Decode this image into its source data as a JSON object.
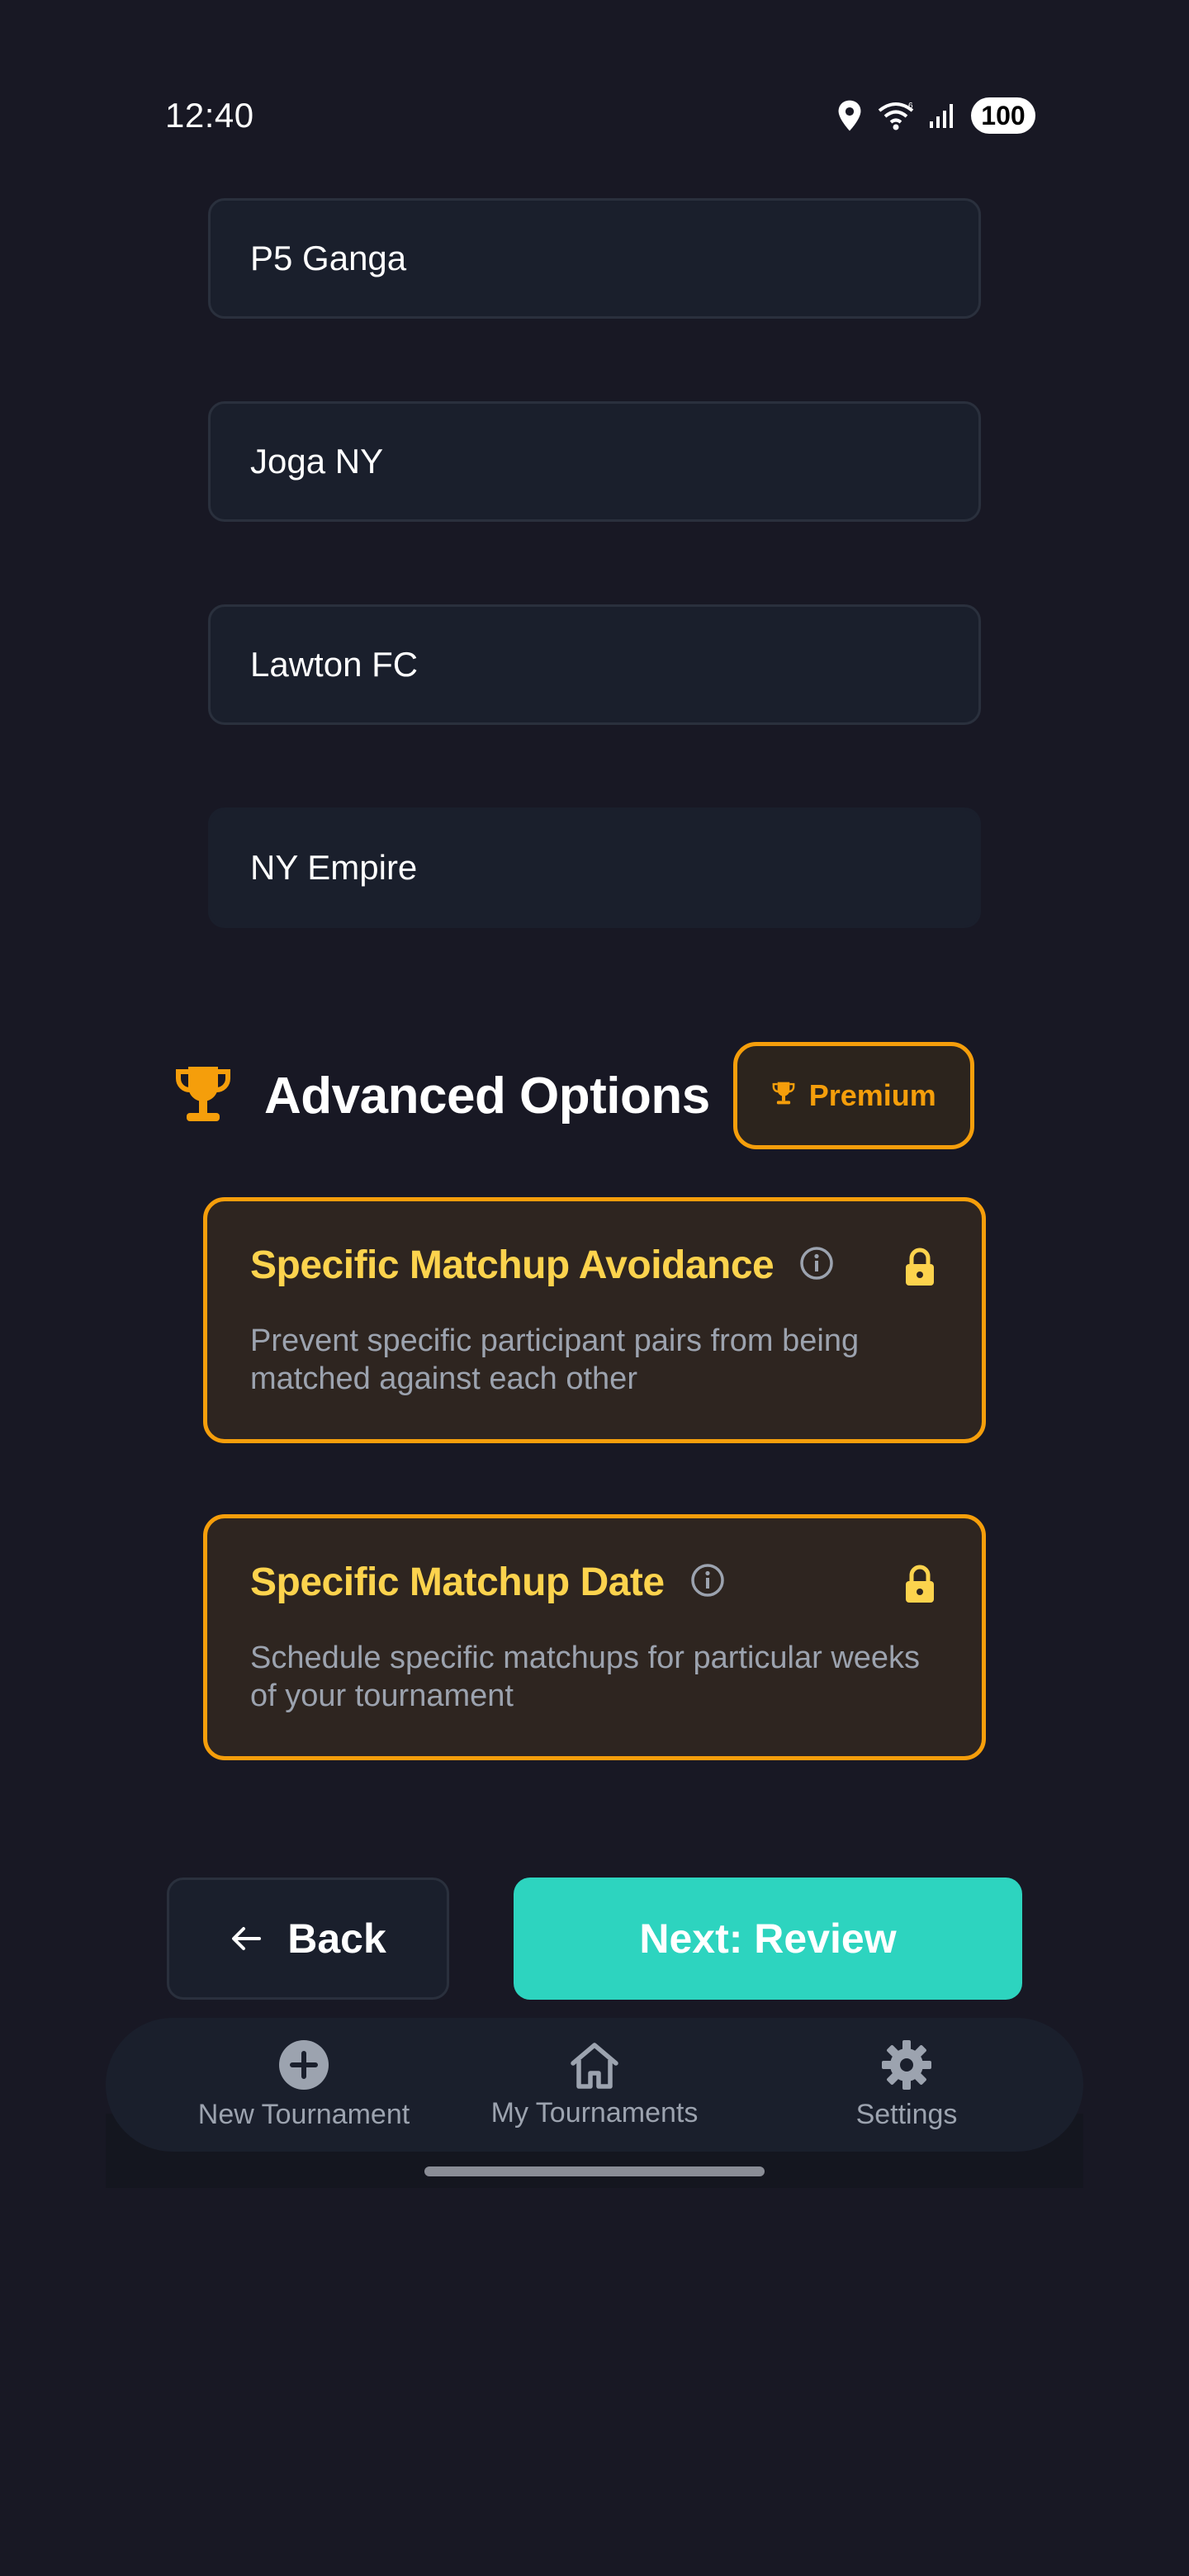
{
  "status_bar": {
    "time": "12:40",
    "battery": "100",
    "icons": [
      "location-icon",
      "wifi-icon",
      "signal-icon",
      "battery-icon"
    ]
  },
  "participants": [
    {
      "name": "P5 Ganga"
    },
    {
      "name": "Joga NY"
    },
    {
      "name": "Lawton FC"
    },
    {
      "name": "NY Empire"
    }
  ],
  "advanced_options": {
    "title": "Advanced Options",
    "premium_label": "Premium",
    "options": [
      {
        "title": "Specific Matchup Avoidance",
        "description": "Prevent specific participant pairs from being matched against each other"
      },
      {
        "title": "Specific Matchup Date",
        "description": "Schedule specific matchups for particular weeks of your tournament"
      }
    ]
  },
  "actions": {
    "back_label": "Back",
    "next_label": "Next: Review"
  },
  "bottom_nav": {
    "items": [
      {
        "label": "New Tournament",
        "icon": "plus-circle-icon"
      },
      {
        "label": "My Tournaments",
        "icon": "home-icon"
      },
      {
        "label": "Settings",
        "icon": "gear-icon"
      }
    ]
  },
  "colors": {
    "background": "#181824",
    "accent_orange": "#f59e0b",
    "option_title": "#fcd34d",
    "primary_teal": "#2dd4bf"
  }
}
